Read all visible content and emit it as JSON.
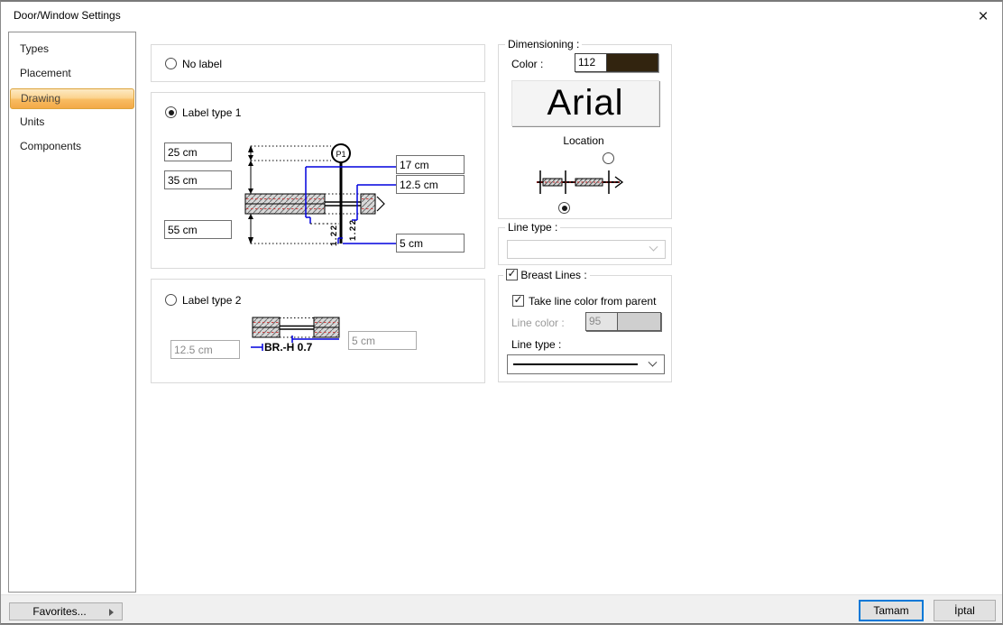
{
  "window": {
    "title": "Door/Window Settings",
    "close_icon": "×"
  },
  "sidebar": {
    "items": [
      {
        "label": "Types"
      },
      {
        "label": "Placement"
      },
      {
        "label": "Drawing"
      },
      {
        "label": "Units"
      },
      {
        "label": "Components"
      }
    ]
  },
  "main": {
    "no_label": "No label",
    "label_type_1": "Label type 1",
    "label_type_2": "Label type 2",
    "lt1_fields": {
      "f1": "25 cm",
      "f2": "35 cm",
      "f3": "55 cm",
      "f4": "17 cm",
      "f5": "12.5 cm",
      "f6": "5 cm"
    },
    "lt2_fields": {
      "f1": "12.5 cm",
      "f2": "5 cm"
    },
    "drawing1": {
      "marker": "P1",
      "dim_left": "1.22",
      "dim_right": "1.22"
    },
    "drawing2": {
      "text": "BR.-H 0.7"
    }
  },
  "dimensioning": {
    "title": "Dimensioning :",
    "color_label": "Color :",
    "color_value": "112",
    "swatch_color": "#32240f",
    "font_name": "Arial",
    "location_label": "Location"
  },
  "line_type_group": {
    "title": "Line type :"
  },
  "breast_lines": {
    "title": "Breast Lines :",
    "take_color_label": "Take line color from parent",
    "line_color_label": "Line color :",
    "line_color_value": "95",
    "line_type_label": "Line type :"
  },
  "footer": {
    "favorites_label": "Favorites...",
    "ok_label": "Tamam",
    "cancel_label": "İptal"
  }
}
